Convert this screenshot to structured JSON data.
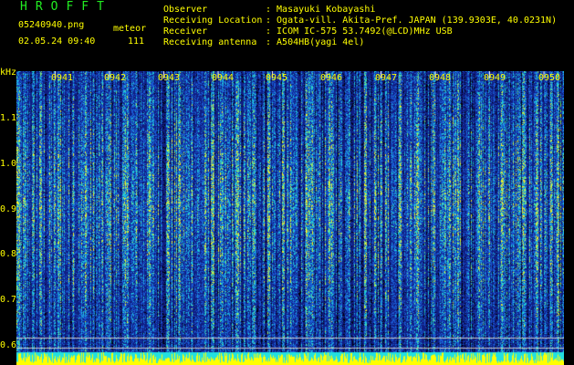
{
  "header": {
    "brand": "HROFFT",
    "filename": "05240940.png",
    "mode": "meteor",
    "datetime": "02.05.24 09:40",
    "count": "111",
    "labels": {
      "observer": "Observer",
      "location": "Receiving Location",
      "receiver": "Receiver",
      "antenna": "Receiving antenna"
    },
    "values": {
      "observer": ": Masayuki Kobayashi",
      "location": ": Ogata-vill. Akita-Pref. JAPAN (139.9303E, 40.0231N)",
      "receiver": ": ICOM IC-575 53.7492(@LCD)MHz USB",
      "antenna": ": A504HB(yagi 4el)"
    }
  },
  "spectrogram": {
    "unit": "kHz",
    "freq_labels": [
      "1.1",
      "1.0",
      "0.9",
      "0.8",
      "0.7",
      "0.6"
    ],
    "minute_labels": [
      "0941",
      "0942",
      "0943",
      "0944",
      "0945",
      "0946",
      "0947",
      "0948",
      "0949",
      "0950"
    ],
    "colors": {
      "background": "#000000",
      "low": "#101a8a",
      "mid": "#1f6fd8",
      "high": "#22e0e0",
      "peak": "#ffff00",
      "reference_line": "#cccccc"
    }
  }
}
